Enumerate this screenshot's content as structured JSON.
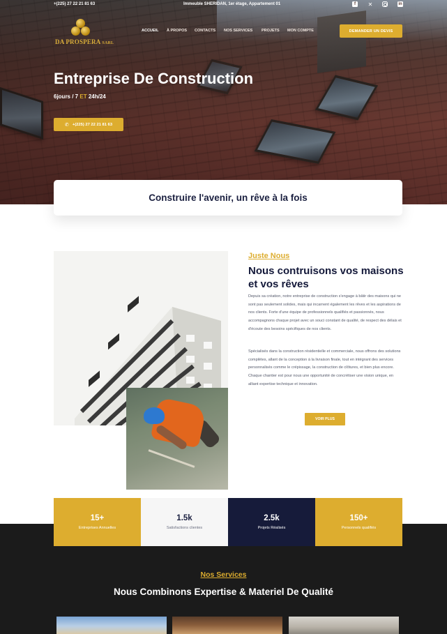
{
  "topbar": {
    "phone": "+(225) 27 22 21 81 63",
    "address": "Immeuble SHERIDAN, 1er étage, Appartement 01",
    "social": [
      "facebook-icon",
      "x-icon",
      "instagram-icon",
      "linkedin-icon"
    ]
  },
  "logo": {
    "name": "DA PROSPERA",
    "suffix": "SARL"
  },
  "nav": {
    "items": [
      "ACCUEIL",
      "À PROPOS",
      "CONTACTS",
      "NOS SERVICES",
      "PROJETS",
      "MON COMPTE"
    ],
    "active": "ACCUEIL"
  },
  "header": {
    "cta_label": "DEMANDER UN DEVIS"
  },
  "hero": {
    "title": "Entreprise De Construction",
    "sub_before": "6jours / 7 ",
    "sub_et": "ET",
    "sub_after": " 24h/24",
    "phone_button": "+(225) 27 22 21 81 63"
  },
  "tagline": "Construire l'avenir, un rêve à la fois",
  "about": {
    "kicker": "Juste Nous",
    "title": "Nous contruisons vos maisons et vos rêves",
    "p1": "Depuis sa création, notre entreprise de construction s'engage à bâtir des maisons qui ne sont pas seulement solides, mais qui incarnent également les rêves et les aspirations de nos clients. Forte d'une équipe de professionnels qualifiés et passionnés, nous accompagnons chaque projet avec un souci constant de qualité, de respect des délais et d'écoute des besoins spécifiques de nos clients.",
    "p2": "Spécialisés dans la construction résidentielle et commerciale, nous offrons des solutions complètes, allant de la conception à la livraison finale, tout en intégrant des services personnalisés comme le crépissage, la construction de clôtures, et bien plus encore. Chaque chantier est pour nous une opportunité de concrétiser une vision unique, en alliant expertise technique et innovation.",
    "button": "VOIR PLUS"
  },
  "stats": [
    {
      "num": "15+",
      "label": "Entreprises Annuelles"
    },
    {
      "num": "1.5k",
      "label": "Satisfactions clientes"
    },
    {
      "num": "2.5k",
      "label": "Projets Réalisés"
    },
    {
      "num": "150+",
      "label": "Personnels qualifiés"
    }
  ],
  "services": {
    "kicker": "Nos Services",
    "title": "Nous Combinons Expertise & Materiel De Qualité"
  },
  "colors": {
    "accent": "#ddad2f",
    "navy": "#161b3a",
    "dark": "#1b1b1b"
  }
}
